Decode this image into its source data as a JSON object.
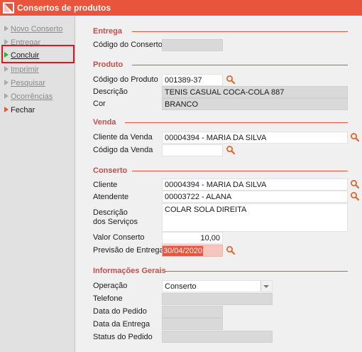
{
  "window": {
    "title": "Consertos de produtos"
  },
  "sidebar": {
    "items": [
      {
        "label": "Novo Conserto",
        "enabled": false
      },
      {
        "label": "Entregar",
        "enabled": false
      },
      {
        "label": "Concluir",
        "enabled": true,
        "selected": true
      },
      {
        "label": "Imprimir",
        "enabled": false
      },
      {
        "label": "Pesquisar",
        "enabled": false
      },
      {
        "label": "Ocorrências",
        "enabled": false
      },
      {
        "label": "Fechar",
        "enabled": true
      }
    ]
  },
  "entrega": {
    "heading": "Entrega",
    "codigo_label": "Código do Conserto",
    "codigo_value": ""
  },
  "produto": {
    "heading": "Produto",
    "codigo_label": "Código do Produto",
    "codigo_value": "001389-37",
    "descricao_label": "Descrição",
    "descricao_value": "TENIS CASUAL COCA-COLA 887",
    "cor_label": "Cor",
    "cor_value": "BRANCO"
  },
  "venda": {
    "heading": "Venda",
    "cliente_label": "Cliente da Venda",
    "cliente_value": "00004394 - MARIA DA SILVA",
    "codigo_label": "Código da Venda",
    "codigo_value": ""
  },
  "conserto": {
    "heading": "Conserto",
    "cliente_label": "Cliente",
    "cliente_value": "00004394 - MARIA DA SILVA",
    "atendente_label": "Atendente",
    "atendente_value": "00003722 - ALANA",
    "descricao_label_1": "Descrição",
    "descricao_label_2": "dos Serviços",
    "descricao_value": "COLAR SOLA DIREITA",
    "valor_label": "Valor Conserto",
    "valor_value": "10,00",
    "previsao_label": "Previsão de Entrega",
    "previsao_value": "30/04/2020"
  },
  "info": {
    "heading": "Informações Gerais",
    "operacao_label": "Operação",
    "operacao_value": "Conserto",
    "telefone_label": "Telefone",
    "telefone_value": "",
    "data_pedido_label": "Data do Pedido",
    "data_pedido_value": "",
    "data_entrega_label": "Data da Entrega",
    "data_entrega_value": "",
    "status_label": "Status do Pedido",
    "status_value": ""
  },
  "colors": {
    "accent": "#e8543c",
    "section": "#c0504d",
    "highlight": "#e3161c",
    "active_arrow": "#2db52d",
    "fechar_arrow": "#e8543c"
  },
  "icons": {
    "search": "search-icon"
  }
}
